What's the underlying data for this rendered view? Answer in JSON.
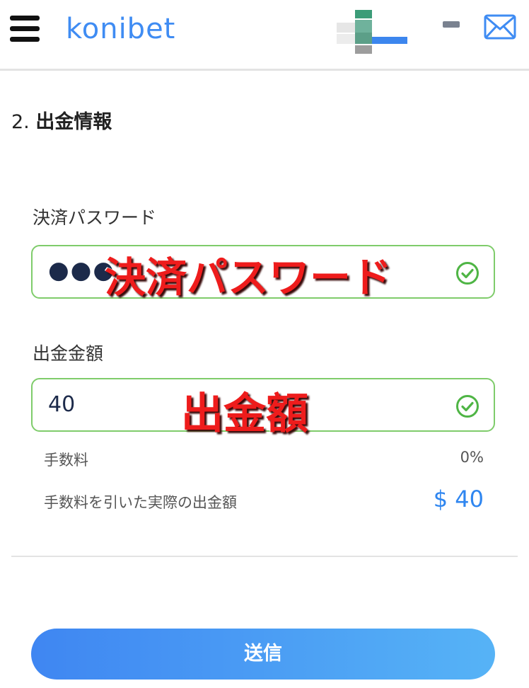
{
  "header": {
    "logo_text": "konibet",
    "menu_icon": "hamburger-menu-icon",
    "minimize_icon": "minus-icon",
    "mail_icon": "mail-icon",
    "colors": {
      "brand": "#3f8cf3",
      "divider": "#e3e3e3"
    }
  },
  "section": {
    "number": "2.",
    "title": "出金情報"
  },
  "password_field": {
    "label": "決済パスワード",
    "value": "●●●",
    "overlay_annotation": "決済パスワード",
    "status_icon": "check-circle-icon"
  },
  "amount_field": {
    "label": "出金金額",
    "value": "40",
    "overlay_annotation": "出金額",
    "status_icon": "check-circle-icon"
  },
  "fee": {
    "label": "手数料",
    "value": "0%"
  },
  "net_amount": {
    "label": "手数料を引いた実際の出金額",
    "value": "$ 40"
  },
  "submit": {
    "label": "送信",
    "colors": {
      "start": "#3f86f2",
      "end": "#56b3f6"
    }
  },
  "colors": {
    "valid_border": "#7fcc6b",
    "annotation": "#ee1c1c",
    "accent": "#2f86f0"
  }
}
